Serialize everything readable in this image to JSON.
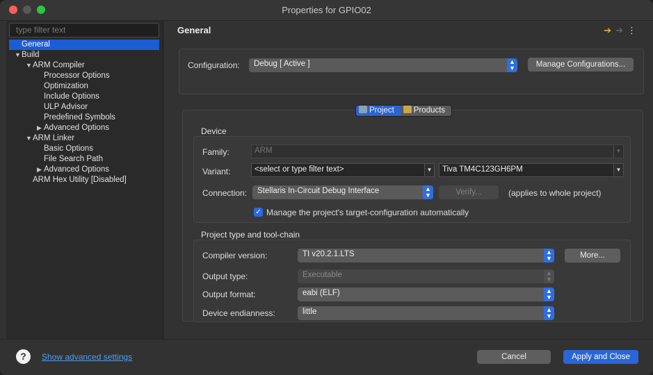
{
  "window": {
    "title": "Properties for GPIO02"
  },
  "sidebar": {
    "filter_placeholder": "type filter text",
    "items": [
      {
        "label": "General"
      },
      {
        "label": "Build"
      },
      {
        "label": "ARM Compiler"
      },
      {
        "label": "Processor Options"
      },
      {
        "label": "Optimization"
      },
      {
        "label": "Include Options"
      },
      {
        "label": "ULP Advisor"
      },
      {
        "label": "Predefined Symbols"
      },
      {
        "label": "Advanced Options"
      },
      {
        "label": "ARM Linker"
      },
      {
        "label": "Basic Options"
      },
      {
        "label": "File Search Path"
      },
      {
        "label": "Advanced Options"
      },
      {
        "label": "ARM Hex Utility  [Disabled]"
      }
    ]
  },
  "main": {
    "title": "General",
    "config": {
      "label": "Configuration:",
      "value": "Debug  [ Active ]",
      "manage_button": "Manage Configurations..."
    },
    "tabs": [
      {
        "label": "Project"
      },
      {
        "label": "Products"
      }
    ],
    "device": {
      "title": "Device",
      "family_label": "Family:",
      "family_value": "ARM",
      "variant_label": "Variant:",
      "variant_filter": "<select or type filter text>",
      "variant_value": "Tiva TM4C123GH6PM",
      "connection_label": "Connection:",
      "connection_value": "Stellaris In-Circuit Debug Interface",
      "verify_button": "Verify...",
      "applies_note": "(applies to whole project)",
      "manage_checkbox": "Manage the project's target-configuration automatically"
    },
    "toolchain": {
      "title": "Project type and tool-chain",
      "compiler_label": "Compiler version:",
      "compiler_value": "TI v20.2.1.LTS",
      "more_button": "More...",
      "output_type_label": "Output type:",
      "output_type_value": "Executable",
      "output_format_label": "Output format:",
      "output_format_value": "eabi (ELF)",
      "endianness_label": "Device endianness:",
      "endianness_value": "little"
    }
  },
  "footer": {
    "help_glyph": "?",
    "advanced_link": "Show advanced settings",
    "cancel_button": "Cancel",
    "apply_button": "Apply and Close"
  }
}
